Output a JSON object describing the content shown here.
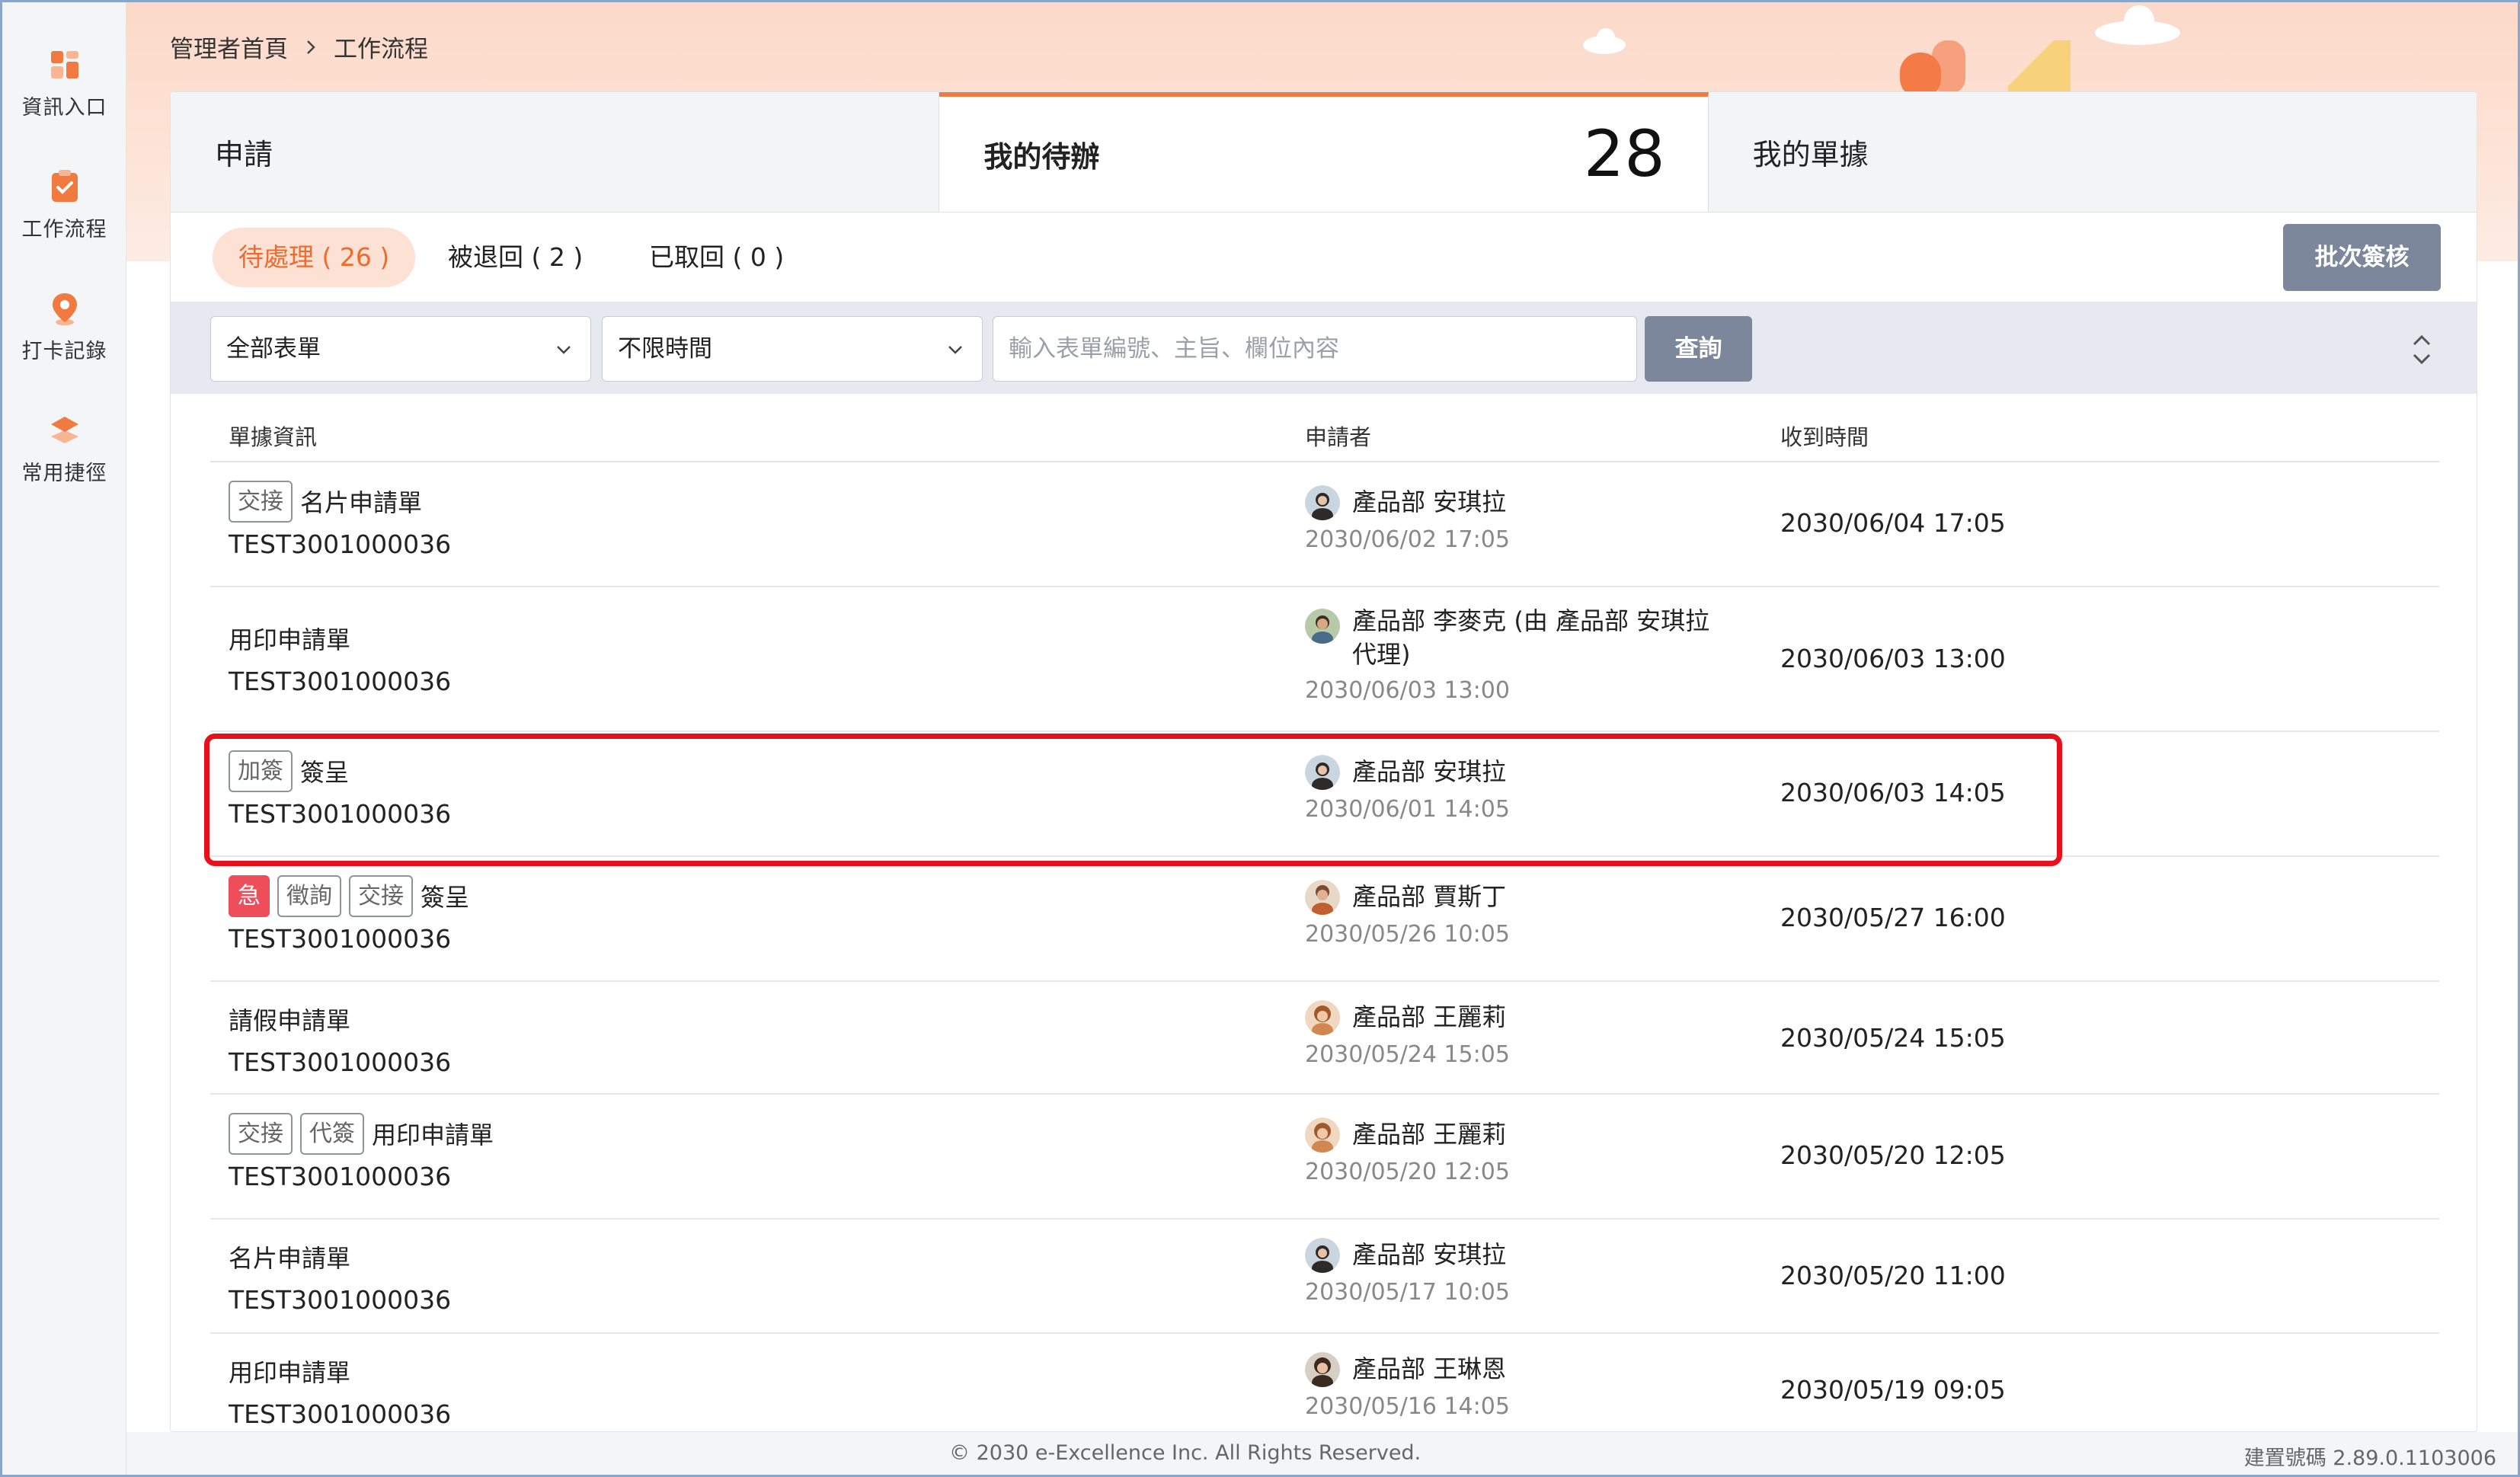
{
  "sidebar": {
    "items": [
      {
        "label": "資訊入口",
        "icon": "portal-grid-icon"
      },
      {
        "label": "工作流程",
        "icon": "workflow-clipboard-icon"
      },
      {
        "label": "打卡記錄",
        "icon": "location-pin-icon"
      },
      {
        "label": "常用捷徑",
        "icon": "layers-icon"
      }
    ]
  },
  "breadcrumb": {
    "home": "管理者首頁",
    "current": "工作流程"
  },
  "tabs": {
    "apply": "申請",
    "todo": "我的待辦",
    "todo_count": "28",
    "mine": "我的單據"
  },
  "subtabs": {
    "pending": "待處理 ( 26 )",
    "returned": "被退回 ( 2 )",
    "withdrawn": "已取回 ( 0 )"
  },
  "batch_button": "批次簽核",
  "filters": {
    "form_select": "全部表單",
    "time_select": "不限時間",
    "search_placeholder": "輸入表單編號、主旨、欄位內容",
    "query_button": "查詢"
  },
  "table": {
    "headers": {
      "info": "單據資訊",
      "applicant": "申請者",
      "received": "收到時間"
    },
    "rows": [
      {
        "tags": [
          "交接"
        ],
        "title": "名片申請單",
        "docno": "TEST3001000036",
        "applicant": "產品部 安琪拉",
        "applied": "2030/06/02 17:05",
        "received": "2030/06/04 17:05"
      },
      {
        "tags": [],
        "title": "用印申請單",
        "docno": "TEST3001000036",
        "applicant": "產品部 李麥克 (由 產品部 安琪拉 代理)",
        "applied": "2030/06/03 13:00",
        "received": "2030/06/03 13:00"
      },
      {
        "tags": [
          "加簽"
        ],
        "title": "簽呈",
        "docno": "TEST3001000036",
        "applicant": "產品部 安琪拉",
        "applied": "2030/06/01 14:05",
        "received": "2030/06/03 14:05"
      },
      {
        "tags": [
          "急",
          "徵詢",
          "交接"
        ],
        "title": "簽呈",
        "docno": "TEST3001000036",
        "applicant": "產品部 賈斯丁",
        "applied": "2030/05/26 10:05",
        "received": "2030/05/27 16:00"
      },
      {
        "tags": [],
        "title": "請假申請單",
        "docno": "TEST3001000036",
        "applicant": "產品部 王麗莉",
        "applied": "2030/05/24 15:05",
        "received": "2030/05/24 15:05"
      },
      {
        "tags": [
          "交接",
          "代簽"
        ],
        "title": "用印申請單",
        "docno": "TEST3001000036",
        "applicant": "產品部 王麗莉",
        "applied": "2030/05/20 12:05",
        "received": "2030/05/20 12:05"
      },
      {
        "tags": [],
        "title": "名片申請單",
        "docno": "TEST3001000036",
        "applicant": "產品部 安琪拉",
        "applied": "2030/05/17 10:05",
        "received": "2030/05/20 11:00"
      },
      {
        "tags": [],
        "title": "用印申請單",
        "docno": "TEST3001000036",
        "applicant": "產品部 王琳恩",
        "applied": "2030/05/16 14:05",
        "received": "2030/05/19 09:05"
      }
    ]
  },
  "footer": {
    "copyright": "© 2030 e-Excellence Inc. All Rights Reserved.",
    "build": "建置號碼 2.89.0.1103006"
  },
  "colors": {
    "accent": "#f07a3f",
    "highlight": "#e8101a",
    "button": "#7c879b",
    "urgent": "#ee4d5a"
  }
}
